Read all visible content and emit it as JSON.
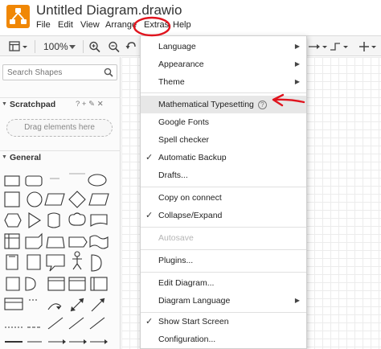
{
  "app": {
    "title": "Untitled Diagram.drawio",
    "menubar": [
      "File",
      "Edit",
      "View",
      "Arrange",
      "Extras",
      "Help"
    ]
  },
  "toolbar": {
    "zoom": "100%"
  },
  "sidebar": {
    "search_placeholder": "Search Shapes",
    "scratchpad": {
      "title": "Scratchpad",
      "tools": "? + ✎ ✕",
      "drop_hint": "Drag elements here"
    },
    "general": {
      "title": "General"
    }
  },
  "extras_menu": {
    "items": [
      {
        "label": "Language",
        "submenu": "▶"
      },
      {
        "label": "Appearance",
        "submenu": "▶"
      },
      {
        "label": "Theme",
        "submenu": "▶"
      },
      {
        "label": "Mathematical Typesetting",
        "help": "?"
      },
      {
        "label": "Google Fonts"
      },
      {
        "label": "Spell checker"
      },
      {
        "label": "Automatic Backup",
        "check": "✓"
      },
      {
        "label": "Drafts..."
      },
      {
        "label": "Copy on connect"
      },
      {
        "label": "Collapse/Expand",
        "check": "✓"
      },
      {
        "label": "Autosave"
      },
      {
        "label": "Plugins..."
      },
      {
        "label": "Edit Diagram..."
      },
      {
        "label": "Diagram Language",
        "submenu": "▶"
      },
      {
        "label": "Show Start Screen",
        "check": "✓"
      },
      {
        "label": "Configuration..."
      }
    ]
  },
  "colors": {
    "logo": "#f08705",
    "annotation": "#e0141e"
  }
}
